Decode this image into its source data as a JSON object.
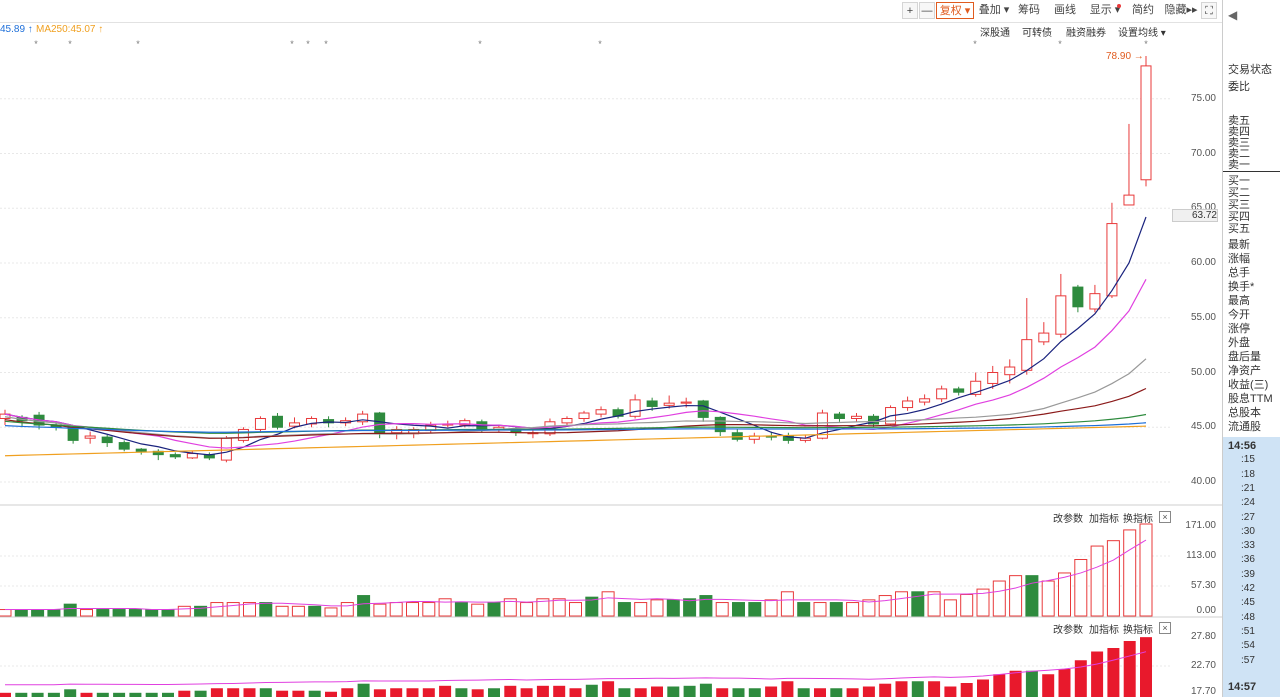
{
  "toolbar": {
    "plus": "+",
    "minus": "—",
    "fuquan": "复权",
    "diejia": "叠加",
    "choumao": "筹码",
    "huaxian": "画线",
    "xianshi": "显示",
    "jianyue": "简约",
    "yincang": "隐藏",
    "expand": "⛶"
  },
  "ma_labels": {
    "ma_left": "45.89",
    "ma250": "MA250:45.07"
  },
  "links": {
    "shengutong": "深股通",
    "kezhuanzhai": "可转债",
    "rongzi": "融资融券",
    "shezhi": "设置均线"
  },
  "price_axis": [
    "75.00",
    "70.00",
    "65.00",
    "60.00",
    "55.00",
    "50.00",
    "45.00",
    "40.00"
  ],
  "current_price": "63.72",
  "high_marker": "78.90",
  "vol_axis": [
    "171.00",
    "113.00",
    "57.30",
    "0.00"
  ],
  "ind_axis": [
    "27.80",
    "22.70",
    "17.70"
  ],
  "panel_tools": {
    "gaicanshu": "改参数",
    "jiazhibiao": "加指标",
    "huanzhibiao": "换指标",
    "close": "×"
  },
  "right_panel": {
    "arrow": "◀",
    "jiaoyizhuangtai": "交易状态",
    "weibi": "委比",
    "sells": [
      "卖五",
      "卖四",
      "卖三",
      "卖二",
      "卖一"
    ],
    "buys": [
      "买一",
      "买二",
      "买三",
      "买四",
      "买五"
    ],
    "stats": [
      "最新",
      "涨幅",
      "总手",
      "换手*",
      "最高",
      "今开",
      "涨停",
      "外盘",
      "盘后量",
      "净资产",
      "收益(三)",
      "股息TTM",
      "总股本",
      "流通股"
    ],
    "times": [
      "14:56",
      ":15",
      ":18",
      ":21",
      ":24",
      ":27",
      ":30",
      ":33",
      ":36",
      ":39",
      ":42",
      ":45",
      ":48",
      ":51",
      ":54",
      ":57",
      "14:57"
    ]
  },
  "colors": {
    "up": "#e8393a",
    "down": "#2e8b3e",
    "accent": "#e05b1f",
    "ma5": "#1a237e",
    "ma10": "#e040e0",
    "ma20": "#999999",
    "ma30": "#8b1a1a",
    "ma60": "#2e8b3e",
    "ma120": "#1e6fd9",
    "ma250": "#f0a020"
  },
  "chart_data": {
    "type": "candlestick",
    "ylim": [
      38,
      80
    ],
    "candles": [
      [
        45.8,
        46.2,
        45.2,
        46.6
      ],
      [
        45.9,
        45.6,
        45.0,
        46.1
      ],
      [
        46.1,
        45.2,
        44.8,
        46.4
      ],
      [
        45.2,
        45.0,
        44.7,
        45.5
      ],
      [
        45.0,
        43.8,
        43.5,
        45.2
      ],
      [
        44.0,
        44.2,
        43.5,
        44.6
      ],
      [
        44.1,
        43.6,
        43.2,
        44.3
      ],
      [
        43.6,
        43.0,
        42.8,
        43.8
      ],
      [
        43.0,
        42.8,
        42.5,
        43.1
      ],
      [
        42.8,
        42.5,
        42.0,
        43.0
      ],
      [
        42.5,
        42.3,
        42.1,
        42.7
      ],
      [
        42.2,
        42.6,
        42.1,
        42.8
      ],
      [
        42.5,
        42.2,
        42.0,
        42.7
      ],
      [
        42.0,
        44.0,
        41.8,
        44.2
      ],
      [
        43.8,
        44.8,
        43.6,
        45.0
      ],
      [
        44.8,
        45.8,
        44.5,
        46.0
      ],
      [
        46.0,
        45.0,
        44.8,
        46.3
      ],
      [
        45.1,
        45.4,
        44.9,
        45.9
      ],
      [
        45.3,
        45.8,
        45.0,
        46.0
      ],
      [
        45.7,
        45.4,
        45.0,
        46.0
      ],
      [
        45.4,
        45.6,
        45.1,
        45.9
      ],
      [
        45.5,
        46.2,
        45.2,
        46.5
      ],
      [
        46.3,
        44.5,
        44.0,
        46.4
      ],
      [
        44.5,
        44.8,
        43.9,
        45.1
      ],
      [
        44.4,
        44.8,
        44.0,
        45.0
      ],
      [
        44.7,
        45.2,
        44.5,
        45.5
      ],
      [
        45.2,
        45.3,
        45.0,
        45.6
      ],
      [
        45.2,
        45.6,
        45.0,
        45.8
      ],
      [
        45.5,
        44.8,
        44.5,
        45.7
      ],
      [
        44.8,
        45.0,
        44.6,
        45.2
      ],
      [
        44.8,
        44.6,
        44.2,
        45.0
      ],
      [
        44.5,
        44.5,
        44.0,
        44.8
      ],
      [
        44.4,
        45.5,
        44.2,
        45.8
      ],
      [
        45.4,
        45.8,
        45.2,
        46.0
      ],
      [
        45.8,
        46.3,
        45.5,
        46.5
      ],
      [
        46.2,
        46.6,
        45.9,
        46.9
      ],
      [
        46.6,
        46.0,
        45.8,
        46.8
      ],
      [
        46.0,
        47.5,
        45.8,
        48.0
      ],
      [
        47.4,
        46.9,
        46.5,
        47.7
      ],
      [
        47.0,
        47.2,
        46.7,
        47.9
      ],
      [
        47.2,
        47.3,
        46.8,
        47.7
      ],
      [
        47.4,
        45.9,
        45.5,
        47.5
      ],
      [
        45.9,
        44.6,
        44.2,
        46.0
      ],
      [
        44.5,
        43.9,
        43.7,
        44.8
      ],
      [
        43.9,
        44.2,
        43.5,
        44.5
      ],
      [
        44.2,
        44.1,
        43.8,
        44.6
      ],
      [
        44.2,
        43.8,
        43.5,
        44.5
      ],
      [
        43.8,
        44.0,
        43.6,
        44.3
      ],
      [
        44.0,
        46.3,
        43.9,
        46.6
      ],
      [
        46.2,
        45.8,
        45.5,
        46.4
      ],
      [
        45.8,
        46.0,
        45.5,
        46.3
      ],
      [
        46.0,
        45.3,
        45.0,
        46.2
      ],
      [
        45.3,
        46.8,
        45.2,
        47.0
      ],
      [
        46.8,
        47.4,
        46.5,
        47.8
      ],
      [
        47.3,
        47.6,
        47.0,
        48.0
      ],
      [
        47.6,
        48.5,
        47.3,
        48.8
      ],
      [
        48.5,
        48.2,
        47.9,
        48.7
      ],
      [
        48.0,
        49.2,
        47.8,
        50.0
      ],
      [
        49.0,
        50.0,
        48.5,
        50.6
      ],
      [
        49.8,
        50.5,
        49.0,
        51.2
      ],
      [
        50.2,
        53.0,
        49.8,
        56.8
      ],
      [
        52.8,
        53.6,
        52.5,
        54.6
      ],
      [
        53.5,
        57.0,
        53.2,
        59.0
      ],
      [
        57.8,
        56.0,
        55.5,
        58.0
      ],
      [
        55.8,
        57.2,
        55.5,
        58.0
      ],
      [
        57.0,
        63.6,
        56.8,
        65.5
      ],
      [
        65.3,
        66.2,
        65.3,
        72.7
      ],
      [
        67.6,
        78.0,
        67.0,
        78.9
      ]
    ],
    "volume": [
      12,
      12,
      12,
      12,
      22,
      12,
      12,
      12,
      12,
      12,
      12,
      18,
      18,
      25,
      25,
      25,
      25,
      18,
      18,
      18,
      15,
      25,
      38,
      22,
      25,
      25,
      25,
      32,
      25,
      22,
      25,
      32,
      25,
      32,
      32,
      25,
      35,
      45,
      25,
      25,
      30,
      30,
      32,
      38,
      25,
      25,
      25,
      30,
      45,
      25,
      25,
      25,
      25,
      30,
      38,
      45,
      45,
      45,
      30,
      40,
      50,
      65,
      75,
      75,
      65,
      80,
      105,
      130,
      140,
      160,
      171
    ]
  }
}
